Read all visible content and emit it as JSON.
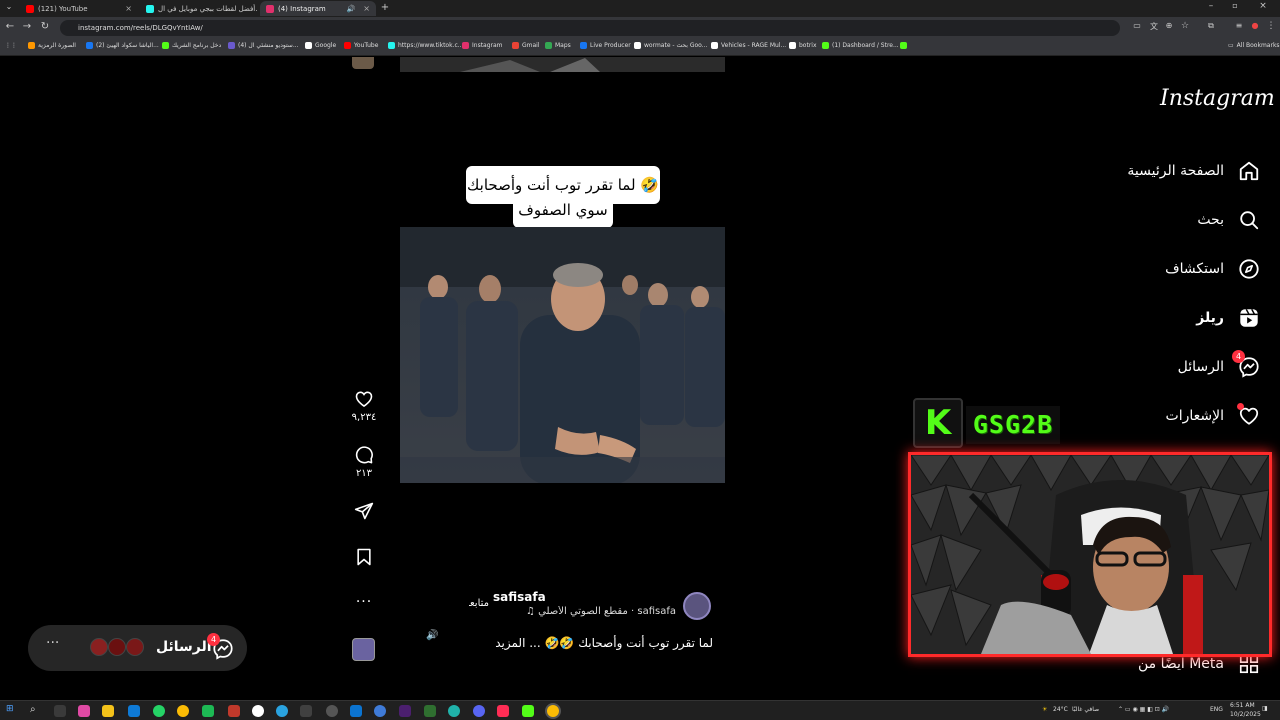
{
  "browser": {
    "tabs": [
      {
        "title": "(121) YouTube",
        "color": "#ff0000"
      },
      {
        "title": "أفضل لقطات ببجي موبايل في ال...",
        "color": "#25f4ee"
      },
      {
        "title": "(4) Instagram",
        "color": "#e1306c"
      }
    ],
    "url": "instagram.com/reels/DLGQvYntIAw/",
    "bookmarks": [
      {
        "label": "الصورة الرمزية",
        "color": "#ff9800"
      },
      {
        "label": "(2) الياشا سكواد الهيئ...",
        "color": "#1877f2"
      },
      {
        "label": "دخل برنامج الشريك",
        "color": "#53fc18"
      },
      {
        "label": "(4) ستوديو منشئي ال...",
        "color": "#6a5acd"
      },
      {
        "label": "Google",
        "color": "#ffffff"
      },
      {
        "label": "YouTube",
        "color": "#ff0000"
      },
      {
        "label": "https://www.tiktok.c...",
        "color": "#25f4ee"
      },
      {
        "label": "Instagram",
        "color": "#e1306c"
      },
      {
        "label": "Gmail",
        "color": "#ea4335"
      },
      {
        "label": "Maps",
        "color": "#34a853"
      },
      {
        "label": "Live Producer",
        "color": "#1877f2"
      },
      {
        "label": "wormate - بحث Goo...",
        "color": "#ffffff"
      },
      {
        "label": "Vehicles - RAGE Mul...",
        "color": "#ffffff"
      },
      {
        "label": "botrix",
        "color": "#ffffff"
      },
      {
        "label": "(1) Dashboard / Stre...",
        "color": "#53fc18"
      }
    ],
    "all_bookmarks": "All Bookmarks"
  },
  "instagram": {
    "logo": "Instagram",
    "nav": [
      {
        "label": "الصفحة الرئيسية",
        "icon": "home-icon"
      },
      {
        "label": "بحث",
        "icon": "search-icon"
      },
      {
        "label": "استكشاف",
        "icon": "explore-icon"
      },
      {
        "label": "ريلز",
        "icon": "reels-icon"
      },
      {
        "label": "الرسائل",
        "icon": "messenger-icon",
        "badge": "4"
      },
      {
        "label": "الإشعارات",
        "icon": "heart-icon"
      }
    ],
    "also_from_meta": "أيضًا من Meta",
    "reel": {
      "caption_line1": "لما تقرر توب أنت وأصحابك 🤣🤣",
      "caption_line2": "سوي الصفوف",
      "likes": "٩,٢٣٤",
      "comments": "٢١٣",
      "username": "safisafa",
      "follow": "متابعة",
      "audio": "safisafa · مقطع الصوتي الأصلي",
      "description": "لما تقرر توب أنت وأصحابك 🤣🤣 ... المزيد"
    },
    "messages_pill": {
      "label": "الرسائل",
      "badge": "4"
    }
  },
  "overlay": {
    "streamer_tag": "GSG2B",
    "kick_letter": "K"
  },
  "taskbar": {
    "weather": "24°C",
    "weather_text": "صافي غالبًا",
    "lang": "ENG",
    "time": "6:51 AM",
    "date": "10/2/2025"
  }
}
